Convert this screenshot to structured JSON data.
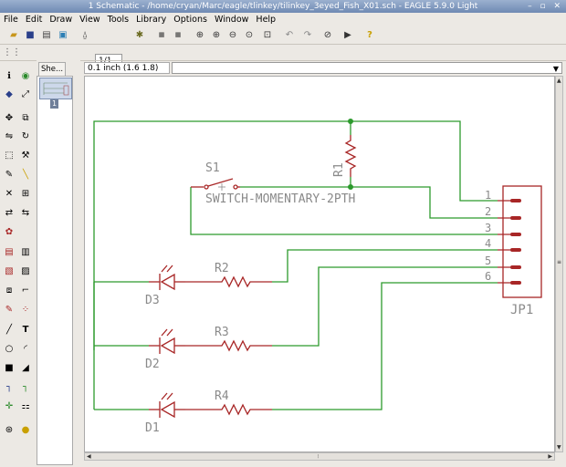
{
  "window": {
    "title": "1 Schematic - /home/cryan/Marc/eagle/tlinkey/tilinkey_3eyed_Fish_X01.sch - EAGLE 5.9.0 Light"
  },
  "menu": [
    "File",
    "Edit",
    "Draw",
    "View",
    "Tools",
    "Library",
    "Options",
    "Window",
    "Help"
  ],
  "toolbar": {
    "sheet_select": "1/1"
  },
  "sheets": {
    "tab_label": "She...",
    "thumb_number": "1"
  },
  "status": {
    "coordinates": "0.1 inch (1.6 1.8)",
    "command": ""
  },
  "schematic": {
    "parts": {
      "s1": {
        "name": "S1",
        "value": "SWITCH-MOMENTARY-2PTH"
      },
      "r1": {
        "name": "R1"
      },
      "r2": {
        "name": "R2"
      },
      "r3": {
        "name": "R3"
      },
      "r4": {
        "name": "R4"
      },
      "d1": {
        "name": "D1"
      },
      "d2": {
        "name": "D2"
      },
      "d3": {
        "name": "D3"
      },
      "jp1": {
        "name": "JP1",
        "pins": [
          "1",
          "2",
          "3",
          "4",
          "5",
          "6"
        ]
      }
    },
    "colors": {
      "wire": "#2c9a2c",
      "symbol": "#a82626",
      "label": "#8a8a8a",
      "junction": "#2c9a2c"
    }
  },
  "colors": {
    "titlebar": "#7f97bf",
    "background": "#ece9e4",
    "canvas": "#ffffff"
  }
}
